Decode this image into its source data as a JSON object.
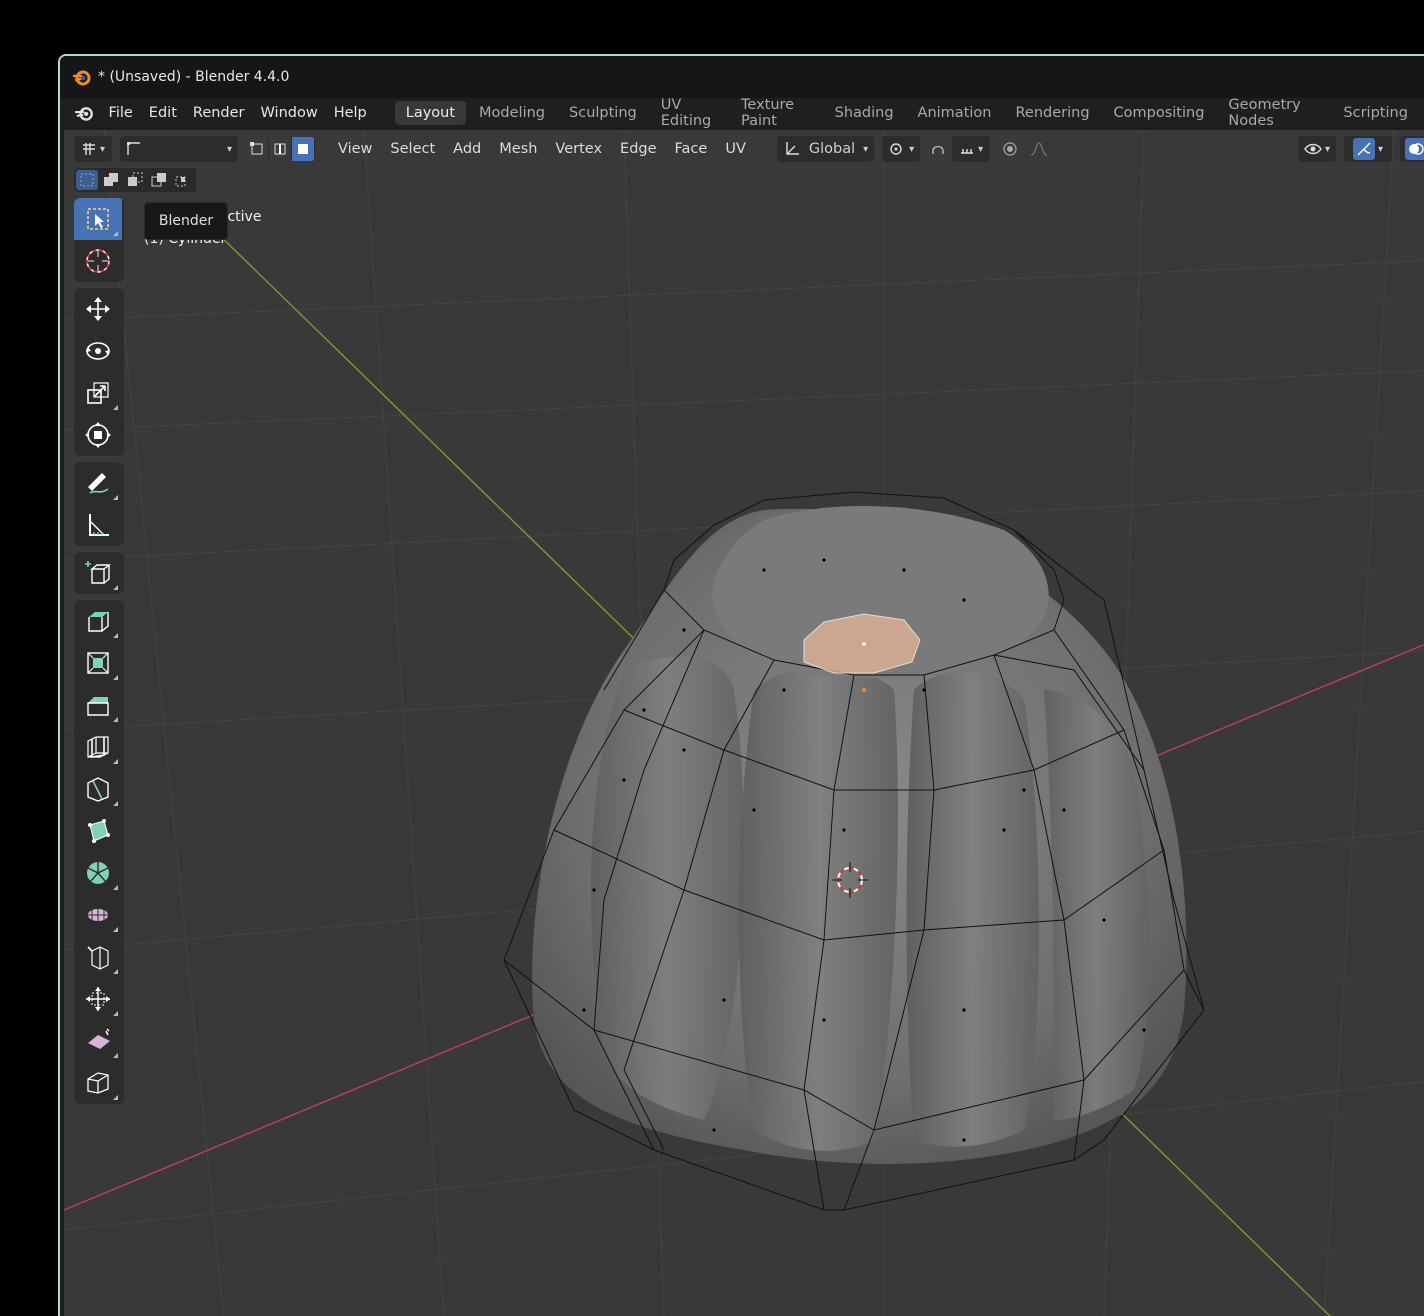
{
  "window": {
    "title": "* (Unsaved) - Blender 4.4.0"
  },
  "menubar": {
    "items": [
      "File",
      "Edit",
      "Render",
      "Window",
      "Help"
    ]
  },
  "workspaces": {
    "tabs": [
      "Layout",
      "Modeling",
      "Sculpting",
      "UV Editing",
      "Texture Paint",
      "Shading",
      "Animation",
      "Rendering",
      "Compositing",
      "Geometry Nodes",
      "Scripting"
    ],
    "active": "Layout",
    "add_symbol": "+"
  },
  "viewport_header": {
    "menus": [
      "View",
      "Select",
      "Add",
      "Mesh",
      "Vertex",
      "Edge",
      "Face",
      "UV"
    ],
    "transform_orientation": "Global",
    "tooltip": "Blender"
  },
  "viewport": {
    "view_name": "User Perspective",
    "object_info": "(1) Cylinder",
    "colors": {
      "background": "#393939",
      "x_axis": "#c0414f",
      "y_axis": "#7d9b2c",
      "grid": "#444444",
      "selected_face": "#e7b79a"
    }
  },
  "toolbar": {
    "tools": [
      "select-box-icon",
      "cursor-icon",
      "move-icon",
      "rotate-icon",
      "scale-icon",
      "transform-icon",
      "annotate-icon",
      "measure-icon",
      "add-cube-icon",
      "extrude-icon",
      "inset-icon",
      "bevel-icon",
      "loop-cut-icon",
      "knife-icon",
      "poly-build-icon",
      "spin-icon",
      "smooth-icon",
      "edge-slide-icon",
      "shrink-fatten-icon",
      "shear-icon",
      "rip-icon"
    ]
  }
}
